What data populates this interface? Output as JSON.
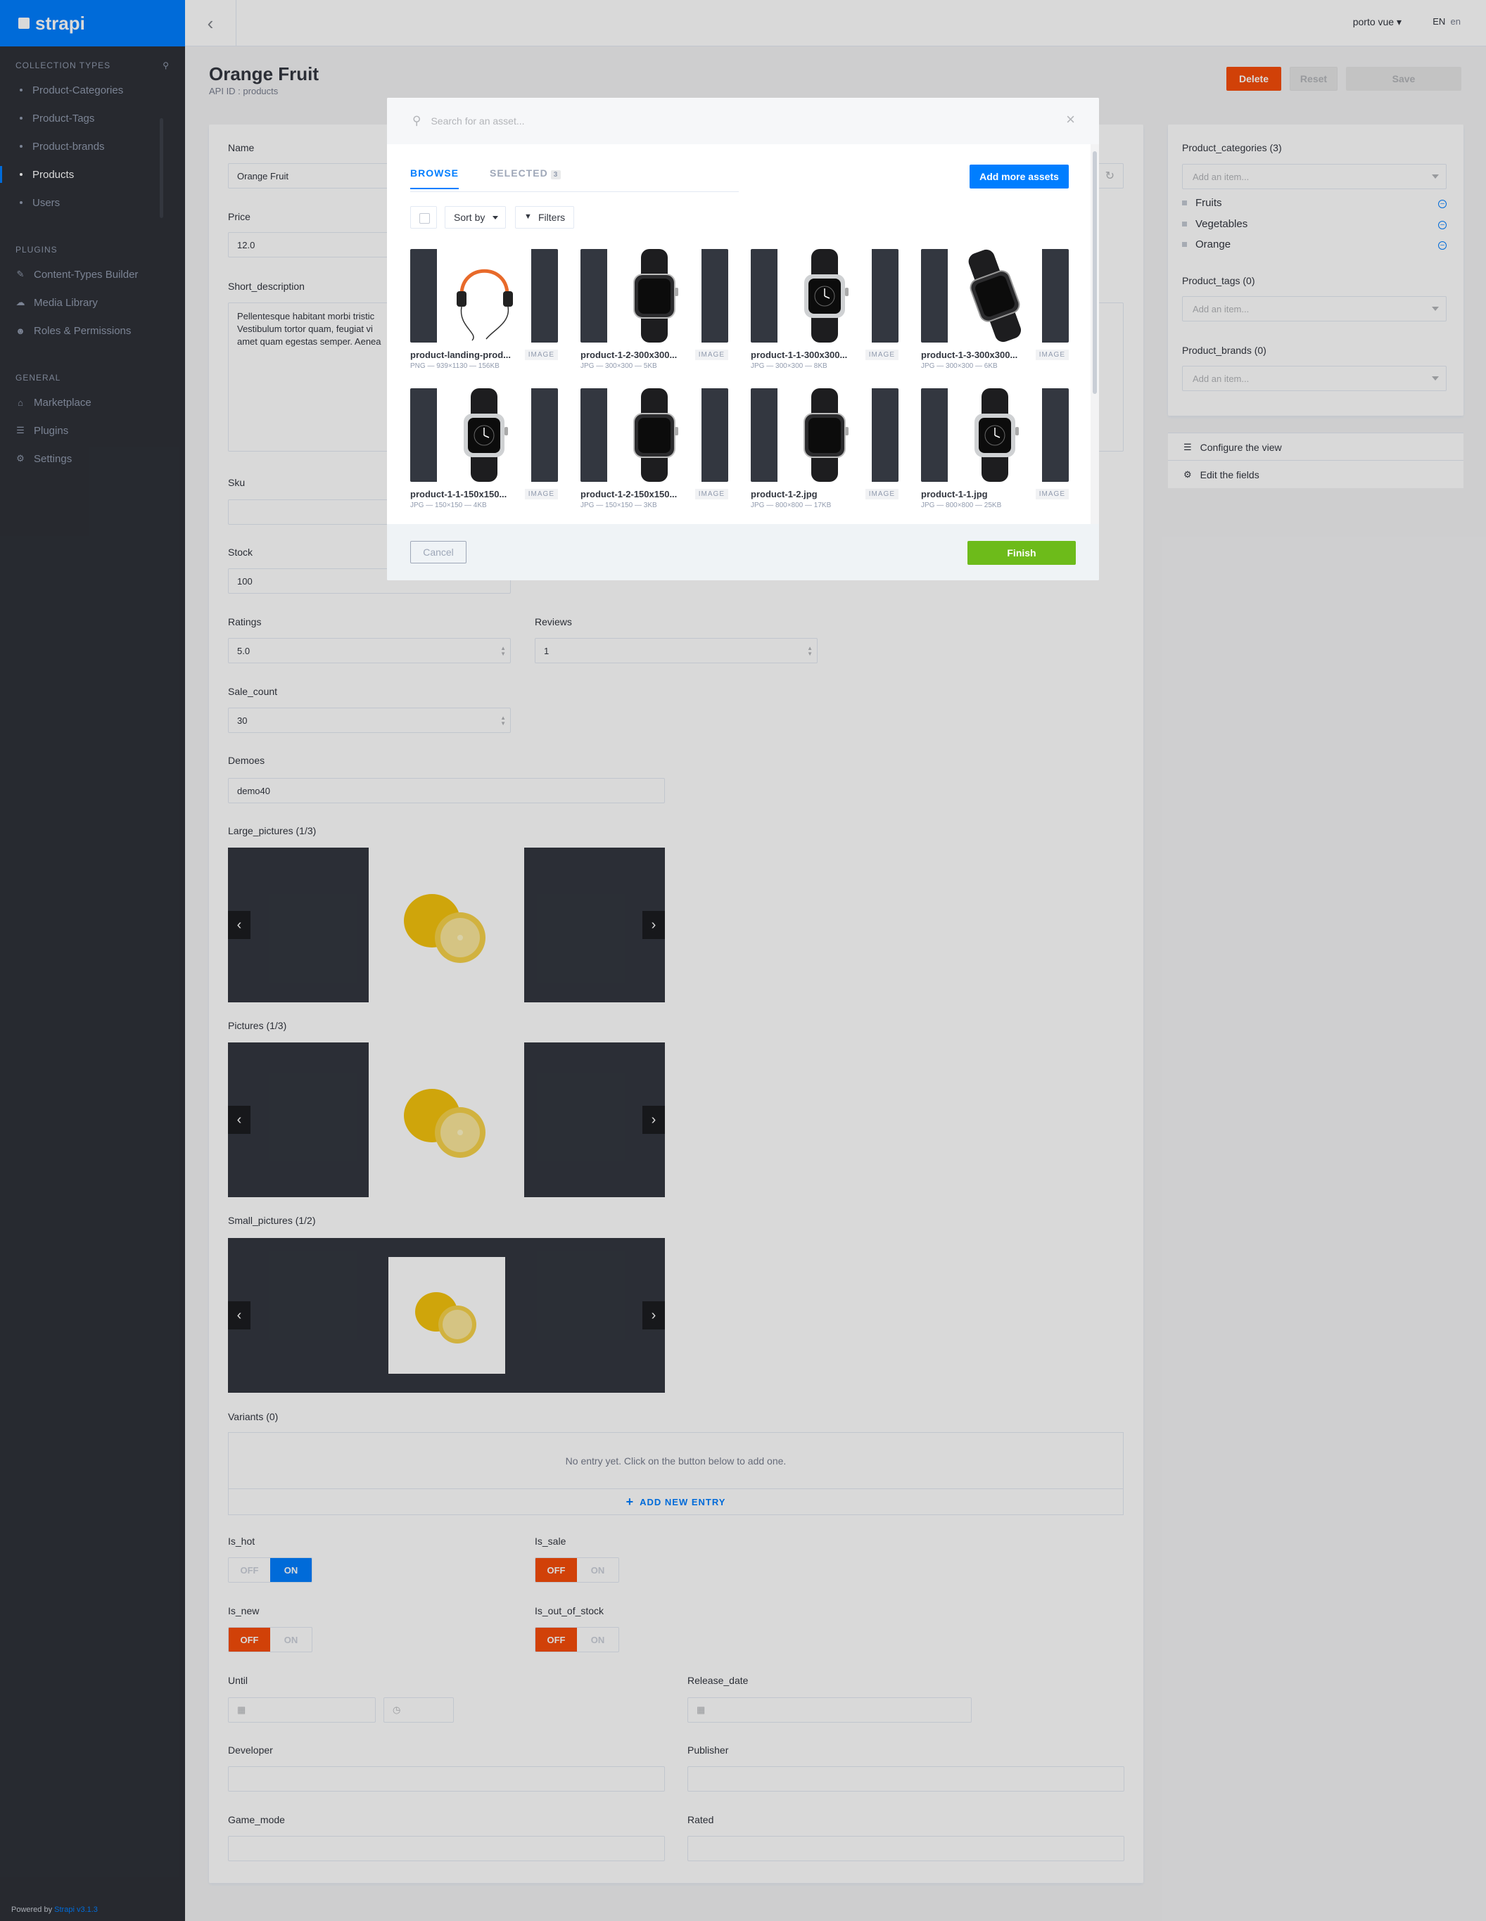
{
  "sidebar": {
    "brand": "strapi",
    "collection_title": "Collection Types",
    "collection_items": [
      "Product-Categories",
      "Product-Tags",
      "Product-brands",
      "Products",
      "Users"
    ],
    "active_item": "Products",
    "plugins_title": "Plugins",
    "plugin_items": [
      "Content-Types Builder",
      "Media Library",
      "Roles & Permissions"
    ],
    "general_title": "General",
    "general_items": [
      "Marketplace",
      "Plugins",
      "Settings"
    ],
    "powered_by": "Powered by",
    "powered_link": "Strapi v3.1.3"
  },
  "topbar": {
    "user": "porto vue",
    "lang": "EN",
    "lang_img_alt": "en"
  },
  "header": {
    "title": "Orange Fruit",
    "api_id": "API ID : products",
    "delete": "Delete",
    "reset": "Reset",
    "save": "Save"
  },
  "form": {
    "name_label": "Name",
    "name_value": "Orange Fruit",
    "price_label": "Price",
    "price_value": "12.0",
    "short_desc_label": "Short_description",
    "short_desc_value": "Pellentesque habitant morbi tristic\nVestibulum tortor quam, feugiat vi\namet quam egestas semper. Aenea",
    "sku_label": "Sku",
    "stock_label": "Stock",
    "stock_value": "100",
    "ratings_label": "Ratings",
    "ratings_value": "5.0",
    "reviews_label": "Reviews",
    "reviews_value": "1",
    "sale_count_label": "Sale_count",
    "sale_count_value": "30",
    "demoes_label": "Demoes",
    "demoes_value": "demo40",
    "large_pictures_label": "Large_pictures (1/3)",
    "pictures_label": "Pictures (1/3)",
    "small_pictures_label": "Small_pictures (1/2)",
    "variants_label": "Variants (0)",
    "variants_empty": "No entry yet. Click on the button below to add one.",
    "add_new_entry": "ADD NEW ENTRY",
    "is_hot_label": "Is_hot",
    "is_sale_label": "Is_sale",
    "is_new_label": "Is_new",
    "is_out_of_stock_label": "Is_out_of_stock",
    "off": "OFF",
    "on": "ON",
    "is_hot": true,
    "is_sale": false,
    "is_new": false,
    "is_out_of_stock": false,
    "until_label": "Until",
    "release_date_label": "Release_date",
    "developer_label": "Developer",
    "publisher_label": "Publisher",
    "game_mode_label": "Game_mode",
    "rated_label": "Rated"
  },
  "relations": {
    "categories_label": "Product_categories (3)",
    "categories": [
      "Fruits",
      "Vegetables",
      "Orange"
    ],
    "tags_label": "Product_tags (0)",
    "brands_label": "Product_brands (0)",
    "placeholder": "Add an item...",
    "configure_view": "Configure the view",
    "edit_fields": "Edit the fields"
  },
  "modal": {
    "search_placeholder": "Search for an asset...",
    "tab_browse": "BROWSE",
    "tab_selected": "SELECTED",
    "selected_count": "3",
    "add_more": "Add more assets",
    "sort_by": "Sort by",
    "filters": "Filters",
    "badge": "IMAGE",
    "assets": [
      {
        "name": "product-landing-prod...",
        "meta": "PNG — 939×1130 — 156KB",
        "kind": "headphones"
      },
      {
        "name": "product-1-2-300x300...",
        "meta": "JPG — 300×300 — 5KB",
        "kind": "watch-black"
      },
      {
        "name": "product-1-1-300x300...",
        "meta": "JPG — 300×300 — 8KB",
        "kind": "watch-face"
      },
      {
        "name": "product-1-3-300x300...",
        "meta": "JPG — 300×300 — 6KB",
        "kind": "watch-angle"
      },
      {
        "name": "product-1-1-150x150...",
        "meta": "JPG — 150×150 — 4KB",
        "kind": "watch-face"
      },
      {
        "name": "product-1-2-150x150...",
        "meta": "JPG — 150×150 — 3KB",
        "kind": "watch-black"
      },
      {
        "name": "product-1-2.jpg",
        "meta": "JPG — 800×800 — 17KB",
        "kind": "watch-black"
      },
      {
        "name": "product-1-1.jpg",
        "meta": "JPG — 800×800 — 25KB",
        "kind": "watch-face"
      }
    ],
    "cancel": "Cancel",
    "finish": "Finish"
  },
  "colors": {
    "accent": "#007eff",
    "danger": "#f64d0a",
    "success": "#6dbb1a",
    "sidebar": "#2e3138"
  }
}
